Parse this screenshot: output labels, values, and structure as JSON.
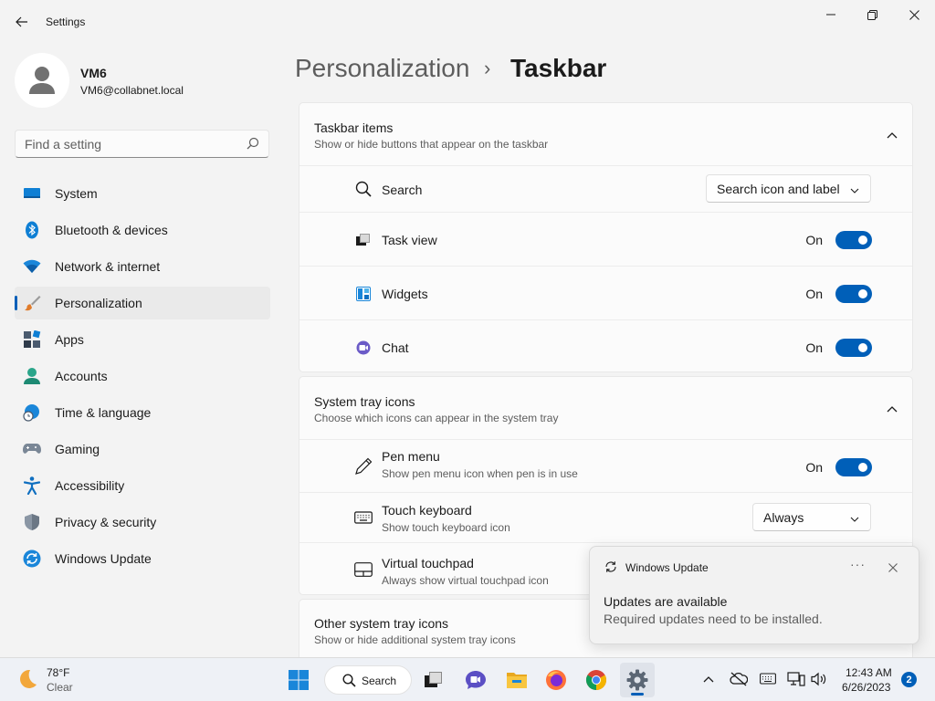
{
  "app": {
    "title": "Settings"
  },
  "user": {
    "name": "VM6",
    "email": "VM6@collabnet.local"
  },
  "search": {
    "placeholder": "Find a setting"
  },
  "sidebar": {
    "items": [
      {
        "label": "System",
        "icon": "system-icon",
        "active": false
      },
      {
        "label": "Bluetooth & devices",
        "icon": "bluetooth-icon",
        "active": false
      },
      {
        "label": "Network & internet",
        "icon": "wifi-icon",
        "active": false
      },
      {
        "label": "Personalization",
        "icon": "brush-icon",
        "active": true
      },
      {
        "label": "Apps",
        "icon": "apps-icon",
        "active": false
      },
      {
        "label": "Accounts",
        "icon": "accounts-icon",
        "active": false
      },
      {
        "label": "Time & language",
        "icon": "globe-clock-icon",
        "active": false
      },
      {
        "label": "Gaming",
        "icon": "gamepad-icon",
        "active": false
      },
      {
        "label": "Accessibility",
        "icon": "accessibility-icon",
        "active": false
      },
      {
        "label": "Privacy & security",
        "icon": "shield-icon",
        "active": false
      },
      {
        "label": "Windows Update",
        "icon": "update-icon",
        "active": false
      }
    ]
  },
  "header": {
    "parent": "Personalization",
    "separator": "›",
    "current": "Taskbar"
  },
  "taskbar_items": {
    "title": "Taskbar items",
    "subtitle": "Show or hide buttons that appear on the taskbar",
    "search": {
      "label": "Search",
      "value": "Search icon and label"
    },
    "task_view": {
      "label": "Task view",
      "state": "On"
    },
    "widgets": {
      "label": "Widgets",
      "state": "On"
    },
    "chat": {
      "label": "Chat",
      "state": "On"
    }
  },
  "system_tray": {
    "title": "System tray icons",
    "subtitle": "Choose which icons can appear in the system tray",
    "pen_menu": {
      "label": "Pen menu",
      "sub": "Show pen menu icon when pen is in use",
      "state": "On"
    },
    "touch_keyboard": {
      "label": "Touch keyboard",
      "sub": "Show touch keyboard icon",
      "value": "Always"
    },
    "virtual_touchpad": {
      "label": "Virtual touchpad",
      "sub": "Always show virtual touchpad icon"
    }
  },
  "other_tray": {
    "title": "Other system tray icons",
    "subtitle": "Show or hide additional system tray icons"
  },
  "toast": {
    "app": "Windows Update",
    "more": "···",
    "title": "Updates are available",
    "body": "Required updates need to be installed."
  },
  "taskbar": {
    "weather": {
      "temp": "78°F",
      "desc": "Clear"
    },
    "search_label": "Search",
    "time": "12:43 AM",
    "date": "6/26/2023",
    "notifications": "2"
  },
  "colors": {
    "accent": "#005fb8",
    "background": "#f3f3f3",
    "card": "#fbfbfb"
  }
}
